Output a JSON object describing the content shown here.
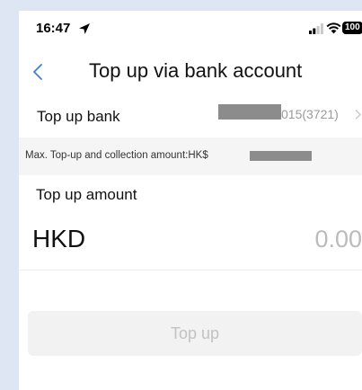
{
  "status_bar": {
    "time": "16:47",
    "battery": "100",
    "icons": [
      "location-arrow-icon",
      "signal-icon",
      "wifi-icon",
      "battery-icon"
    ]
  },
  "nav": {
    "title": "Top up via bank account",
    "back_icon": "chevron-left-icon"
  },
  "bank": {
    "label": "Top up bank",
    "account": "015(3721)",
    "chevron_icon": "chevron-right-icon"
  },
  "limit": {
    "text": "Max. Top-up and collection amount:HK$"
  },
  "amount": {
    "label": "Top up amount",
    "currency": "HKD",
    "placeholder": "0.00"
  },
  "action": {
    "button_label": "Top up"
  },
  "colors": {
    "accent": "#3f7fd6",
    "disabled_button_bg": "#f2f2f2",
    "disabled_button_text": "#c2c2c2",
    "placeholder_text": "#bbbbbb",
    "page_background": "#dde6f2"
  }
}
